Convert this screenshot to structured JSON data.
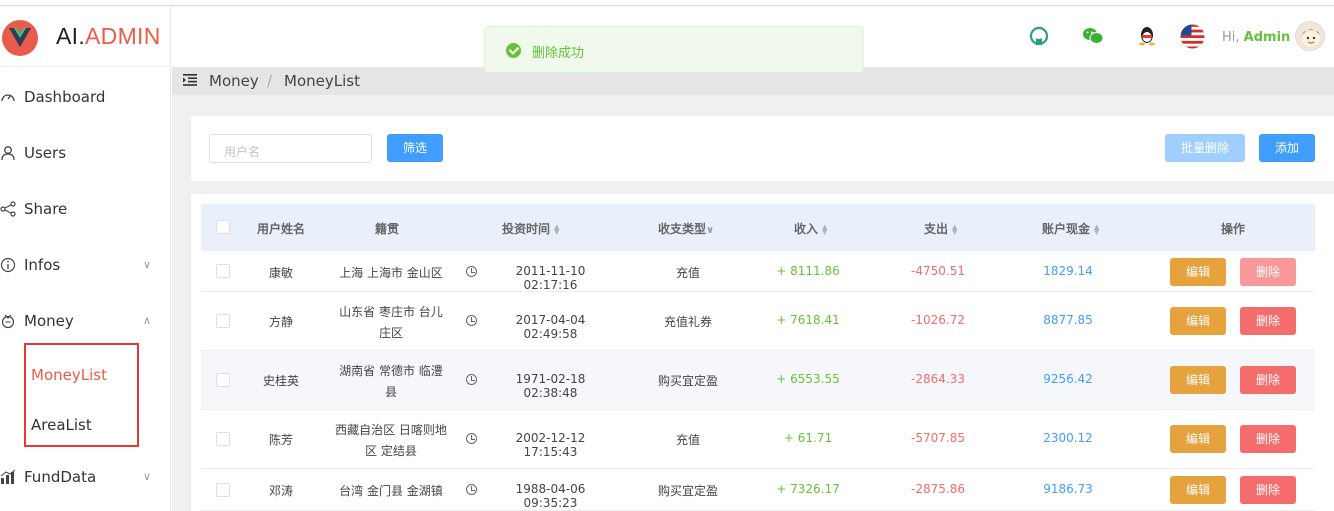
{
  "app": {
    "logo_prefix": "AI.",
    "logo_accent": "ADMIN"
  },
  "sidebar": {
    "items": [
      {
        "label": "Dashboard",
        "icon": "dashboard-icon"
      },
      {
        "label": "Users",
        "icon": "user-icon"
      },
      {
        "label": "Share",
        "icon": "share-icon"
      },
      {
        "label": "Infos",
        "icon": "info-icon"
      },
      {
        "label": "Money",
        "icon": "money-icon"
      },
      {
        "label": "FundData",
        "icon": "chart-icon"
      }
    ],
    "money_sub": [
      "MoneyList",
      "AreaList"
    ]
  },
  "header": {
    "greeting": "Hi, ",
    "user": "Admin"
  },
  "toast": {
    "message": "删除成功"
  },
  "breadcrumb": {
    "level1": "Money",
    "sep": "/",
    "level2": "MoneyList"
  },
  "filter": {
    "search_placeholder": "用户名",
    "filter_label": "筛选",
    "batch_delete_label": "批量删除",
    "add_label": "添加"
  },
  "table": {
    "headers": {
      "name": "用户姓名",
      "origin": "籍贯",
      "time": "投资时间",
      "type": "收支类型",
      "income": "收入",
      "expense": "支出",
      "cash": "账户现金",
      "actions": "操作"
    },
    "edit_label": "编辑",
    "delete_label": "删除",
    "rows": [
      {
        "name": "康敏",
        "origin1": "上海 上海市 金山区",
        "origin2": "",
        "time": "2011-11-10 02:17:16",
        "type": "充值",
        "income": "+ 8111.86",
        "expense": "-4750.51",
        "cash": "1829.14"
      },
      {
        "name": "方静",
        "origin1": "山东省 枣庄市 台儿",
        "origin2": "庄区",
        "time": "2017-04-04 02:49:58",
        "type": "充值礼券",
        "income": "+ 7618.41",
        "expense": "-1026.72",
        "cash": "8877.85"
      },
      {
        "name": "史桂英",
        "origin1": "湖南省 常德市 临澧",
        "origin2": "县",
        "time": "1971-02-18 02:38:48",
        "type": "购买宜定盈",
        "income": "+ 6553.55",
        "expense": "-2864.33",
        "cash": "9256.42"
      },
      {
        "name": "陈芳",
        "origin1": "西藏自治区 日喀则地",
        "origin2": "区 定结县",
        "time": "2002-12-12 17:15:43",
        "type": "充值",
        "income": "+ 61.71",
        "expense": "-5707.85",
        "cash": "2300.12"
      },
      {
        "name": "邓涛",
        "origin1": "台湾 金门县 金湖镇",
        "origin2": "",
        "time": "1988-04-06 09:35:23",
        "type": "购买宜定盈",
        "income": "+ 7326.17",
        "expense": "-2875.86",
        "cash": "9186.73"
      }
    ]
  }
}
